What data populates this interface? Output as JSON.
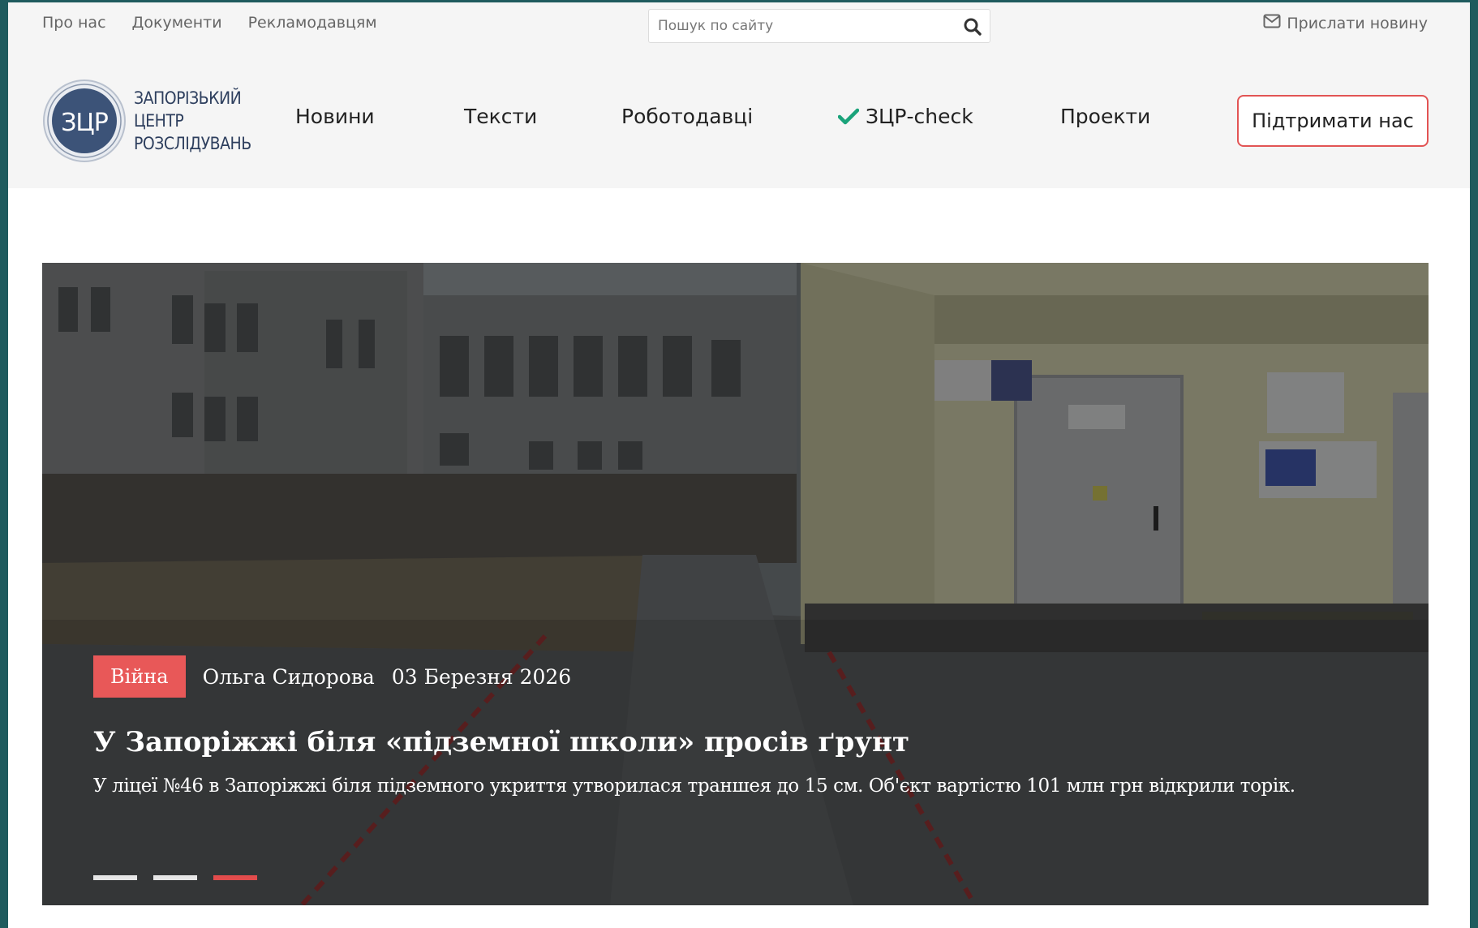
{
  "topbar": {
    "links": [
      "Про нас",
      "Документи",
      "Рекламодавцям"
    ],
    "search_placeholder": "Пошук по сайту",
    "search_icon": "search-icon",
    "send_news_label": "Прислати новину",
    "send_news_icon": "envelope-icon"
  },
  "header": {
    "logo_mark": "ЗЦР",
    "logo_lines": [
      "ЗАПОРІЗЬКИЙ",
      "ЦЕНТР",
      "РОЗСЛІДУВАНЬ"
    ],
    "nav": {
      "news": "Новини",
      "texts": "Тексти",
      "employers": "Роботодавці",
      "check": "ЗЦР-check",
      "projects": "Проекти"
    },
    "check_icon": "checkmark-icon",
    "support_label": "Підтримати нас"
  },
  "hero": {
    "category": "Війна",
    "author": "Ольга Сидорова",
    "date": "03 Березня 2026",
    "title": "У Запоріжжі біля «підземної школи» просів ґрунт",
    "lead": "У ліцеї №46 в Запоріжжі біля підземного укриття утворилася траншея до 15 см. Об'єкт вартістю 101 млн грн відкрили торік.",
    "slides_total": 3,
    "active_slide": 3
  },
  "colors": {
    "accent": "#e85858",
    "logo_blue": "#3c5378",
    "check_green": "#1aa37a",
    "header_bg": "#f5f5f5",
    "outer_bg": "#1f5b5e"
  }
}
